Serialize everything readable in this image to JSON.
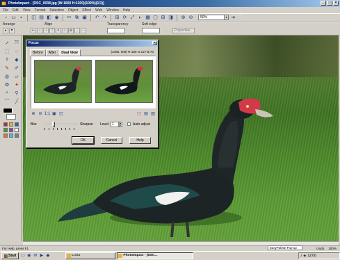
{
  "window": {
    "title": "PhotoImpact - [DSC_0038.jpg (W:1600 H:1200)(100%)(1/1)]",
    "minimize_glyph": "_",
    "maximize_glyph": "□",
    "close_glyph": "×"
  },
  "menu": [
    "File",
    "Edit",
    "View",
    "Format",
    "Selection",
    "Object",
    "Effect",
    "Web",
    "Window",
    "Help"
  ],
  "zoom": {
    "value": "50%",
    "dropdown_glyph": "▾"
  },
  "attribute_bar": {
    "arrange_label": "Arrange",
    "align_label": "Align",
    "transparency_label": "Transparency",
    "soft_edge_label": "Soft edge",
    "properties_label": "Properties..."
  },
  "focus_dialog": {
    "title": "Focus",
    "close_glyph": "×",
    "tabs": [
      {
        "label": "Before"
      },
      {
        "label": "After"
      },
      {
        "label": "Dual View",
        "active": true
      }
    ],
    "info_text": "(1056, 609) R:180 G:127 B:70",
    "blur_label": "Blur",
    "sharpen_label": "Sharpen",
    "level_label": "Level:",
    "level_value": "1",
    "slider_position": 0.25,
    "auto_adjust_label": "Auto adjust",
    "buttons": {
      "ok": "OK",
      "cancel": "Cancel",
      "help": "Help"
    }
  },
  "status": {
    "text": "For Help, press F1",
    "easy_palette": "EasyPalette Pop-up",
    "undo": "Undo",
    "zoom": "100%"
  },
  "taskbar": {
    "start_label": "Start",
    "tasks": [
      {
        "label": "Lucia",
        "active": false
      },
      {
        "label": "PhotoImpact - [DSC...",
        "active": true
      }
    ],
    "clock": "12:00"
  },
  "colors": {
    "titlebar": "#0a246a",
    "duck_body": "#1c2426",
    "duck_wing": "#1f4a4a",
    "caruncle": "#d23a4c",
    "grass": "#4c8a2a"
  },
  "icons": {
    "tool_palette": [
      "pick-icon",
      "transform-icon",
      "standard-selection-icon",
      "lasso-icon",
      "text-icon",
      "shape-icon",
      "paint-icon",
      "clone-icon",
      "fill-icon",
      "eraser-icon",
      "stamp-icon",
      "retouch-icon",
      "zoom-icon",
      "eyedropper-icon",
      "path-icon",
      "line-icon"
    ]
  }
}
